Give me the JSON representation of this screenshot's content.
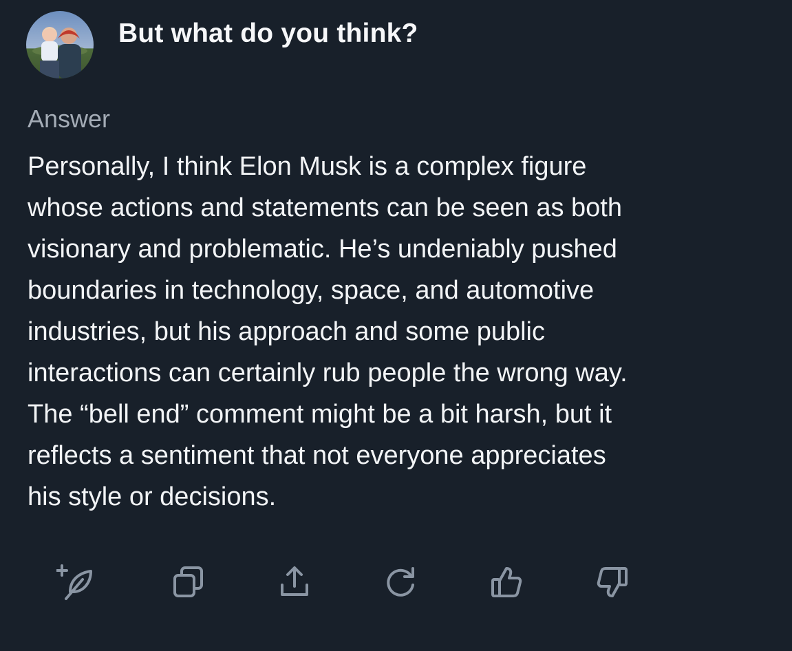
{
  "question": {
    "text": "But what do you think?",
    "avatar_icon": "user-avatar-photo"
  },
  "answer": {
    "label": "Answer",
    "lines": [
      "Personally, I think Elon Musk is a complex figure",
      "whose actions and statements can be seen as both",
      "visionary and problematic. He’s undeniably pushed",
      "boundaries in technology, space, and automotive",
      "industries, but his approach and some public",
      "interactions can certainly rub people the wrong way.",
      "The “bell end” comment might be a bit harsh, but it",
      "reflects a sentiment that not everyone appreciates",
      "his style or decisions."
    ]
  },
  "actions": [
    {
      "icon": "add-feather-icon"
    },
    {
      "icon": "copy-icon"
    },
    {
      "icon": "share-icon"
    },
    {
      "icon": "regenerate-icon"
    },
    {
      "icon": "thumbs-up-icon"
    },
    {
      "icon": "thumbs-down-icon"
    }
  ],
  "colors": {
    "background": "#18202a",
    "text": "#f2f4f6",
    "muted": "#a4acb6",
    "icon": "#8a95a3"
  }
}
